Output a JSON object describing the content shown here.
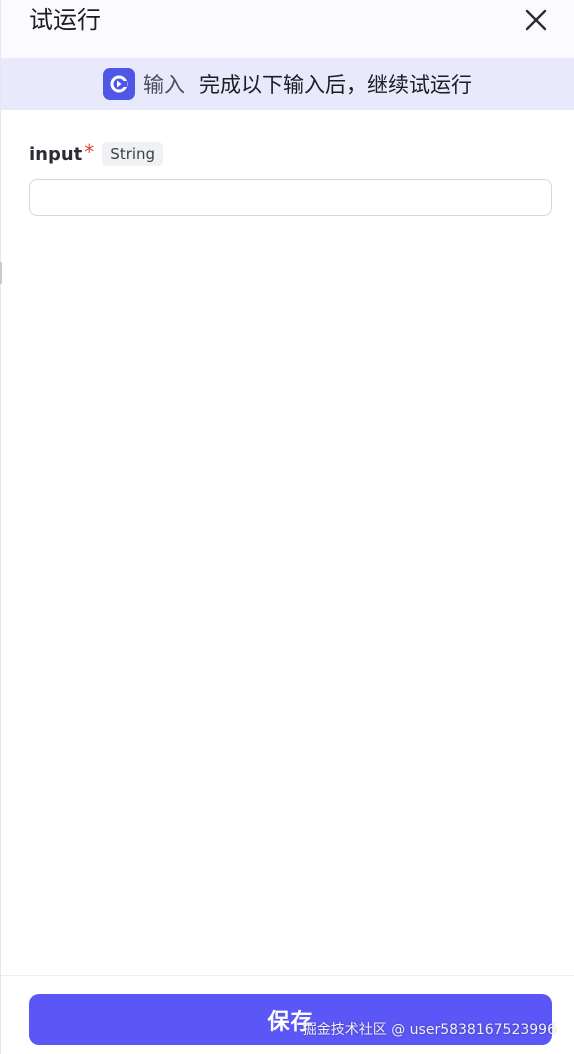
{
  "header": {
    "title": "试运行",
    "close_icon": "close-icon"
  },
  "banner": {
    "icon": "node-input-icon",
    "node_name": "输入",
    "message": "完成以下输入后，继续试运行",
    "accent": "#4f57e6",
    "background": "#e8e9fb"
  },
  "form": {
    "field": {
      "name": "input",
      "required_mark": "*",
      "type": "String",
      "value": "",
      "placeholder": ""
    }
  },
  "footer": {
    "save_label": "保存",
    "button_color": "#5b56f6"
  },
  "watermark": "掘金技术社区 @ user5838167523996"
}
